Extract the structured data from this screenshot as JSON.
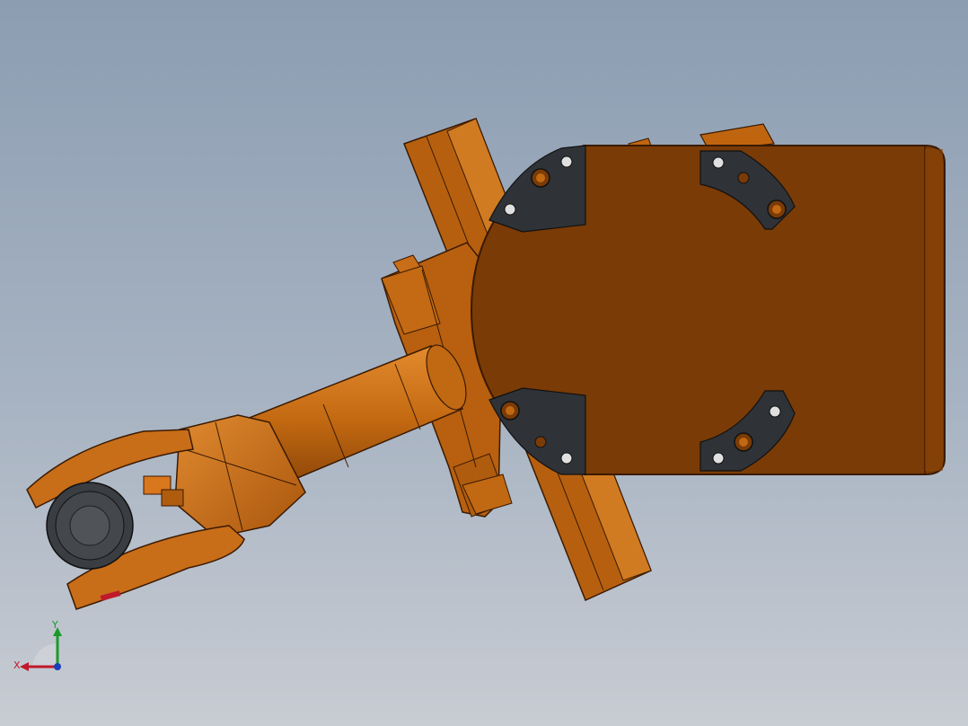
{
  "viewport": {
    "background_top": "#8c9db2",
    "background_bottom": "#c8ccd3"
  },
  "model": {
    "name": "industrial-robot-arm",
    "body_color": "#7a3a06",
    "highlight_color": "#d9771c",
    "edge_color": "#3a1a02",
    "plate_color": "#2f3236",
    "flange_color": "#505458"
  },
  "triad": {
    "x_label": "X",
    "y_label": "Y",
    "x_color": "#c0192a",
    "y_color": "#1a9a2a",
    "z_color": "#1c3fb8"
  }
}
